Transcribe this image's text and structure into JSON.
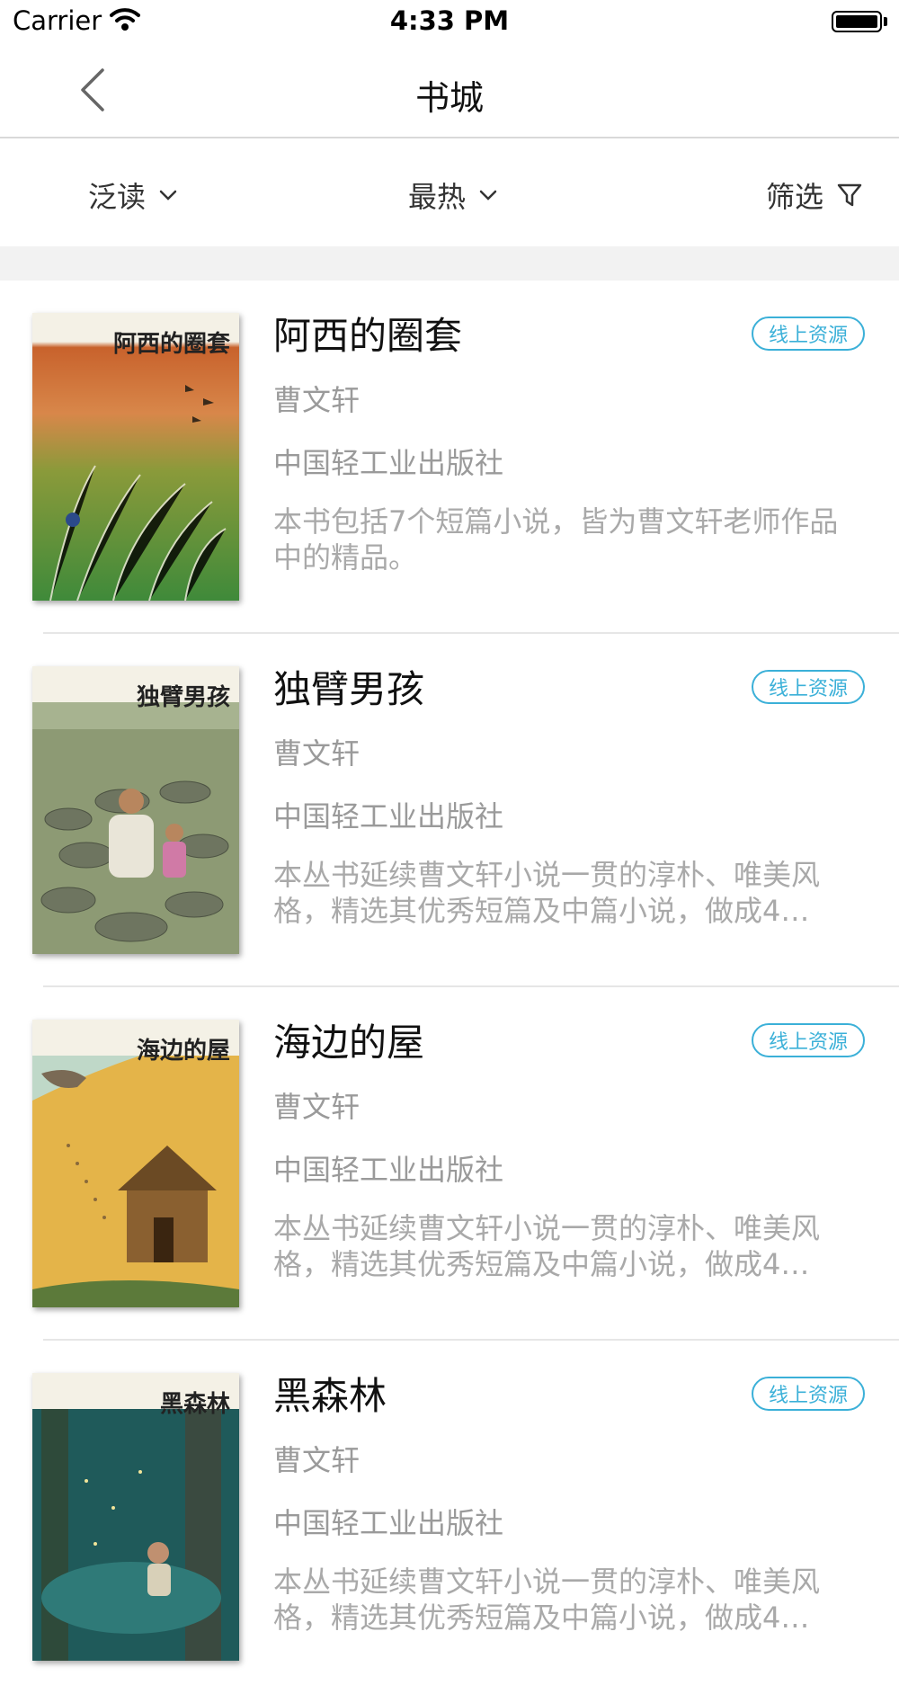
{
  "status_bar": {
    "carrier": "Carrier",
    "time": "4:33 PM"
  },
  "nav": {
    "title": "书城"
  },
  "filters": {
    "category": "泛读",
    "sort": "最热",
    "filter": "筛选"
  },
  "books": [
    {
      "title": "阿西的圈套",
      "cover_title": "阿西的圈套",
      "badge": "线上资源",
      "author": "曹文轩",
      "publisher": "中国轻工业出版社",
      "description": "本书包括7个短篇小说，皆为曹文轩老师作品中的精品。"
    },
    {
      "title": "独臂男孩",
      "cover_title": "独臂男孩",
      "badge": "线上资源",
      "author": "曹文轩",
      "publisher": "中国轻工业出版社",
      "description": "本丛书延续曹文轩小说一贯的淳朴、唯美风格，精选其优秀短篇及中篇小说，做成4…"
    },
    {
      "title": "海边的屋",
      "cover_title": "海边的屋",
      "badge": "线上资源",
      "author": "曹文轩",
      "publisher": "中国轻工业出版社",
      "description": "本丛书延续曹文轩小说一贯的淳朴、唯美风格，精选其优秀短篇及中篇小说，做成4…"
    },
    {
      "title": "黑森林",
      "cover_title": "黑森林",
      "badge": "线上资源",
      "author": "曹文轩",
      "publisher": "中国轻工业出版社",
      "description": "本丛书延续曹文轩小说一贯的淳朴、唯美风格，精选其优秀短篇及中篇小说，做成4…"
    }
  ]
}
